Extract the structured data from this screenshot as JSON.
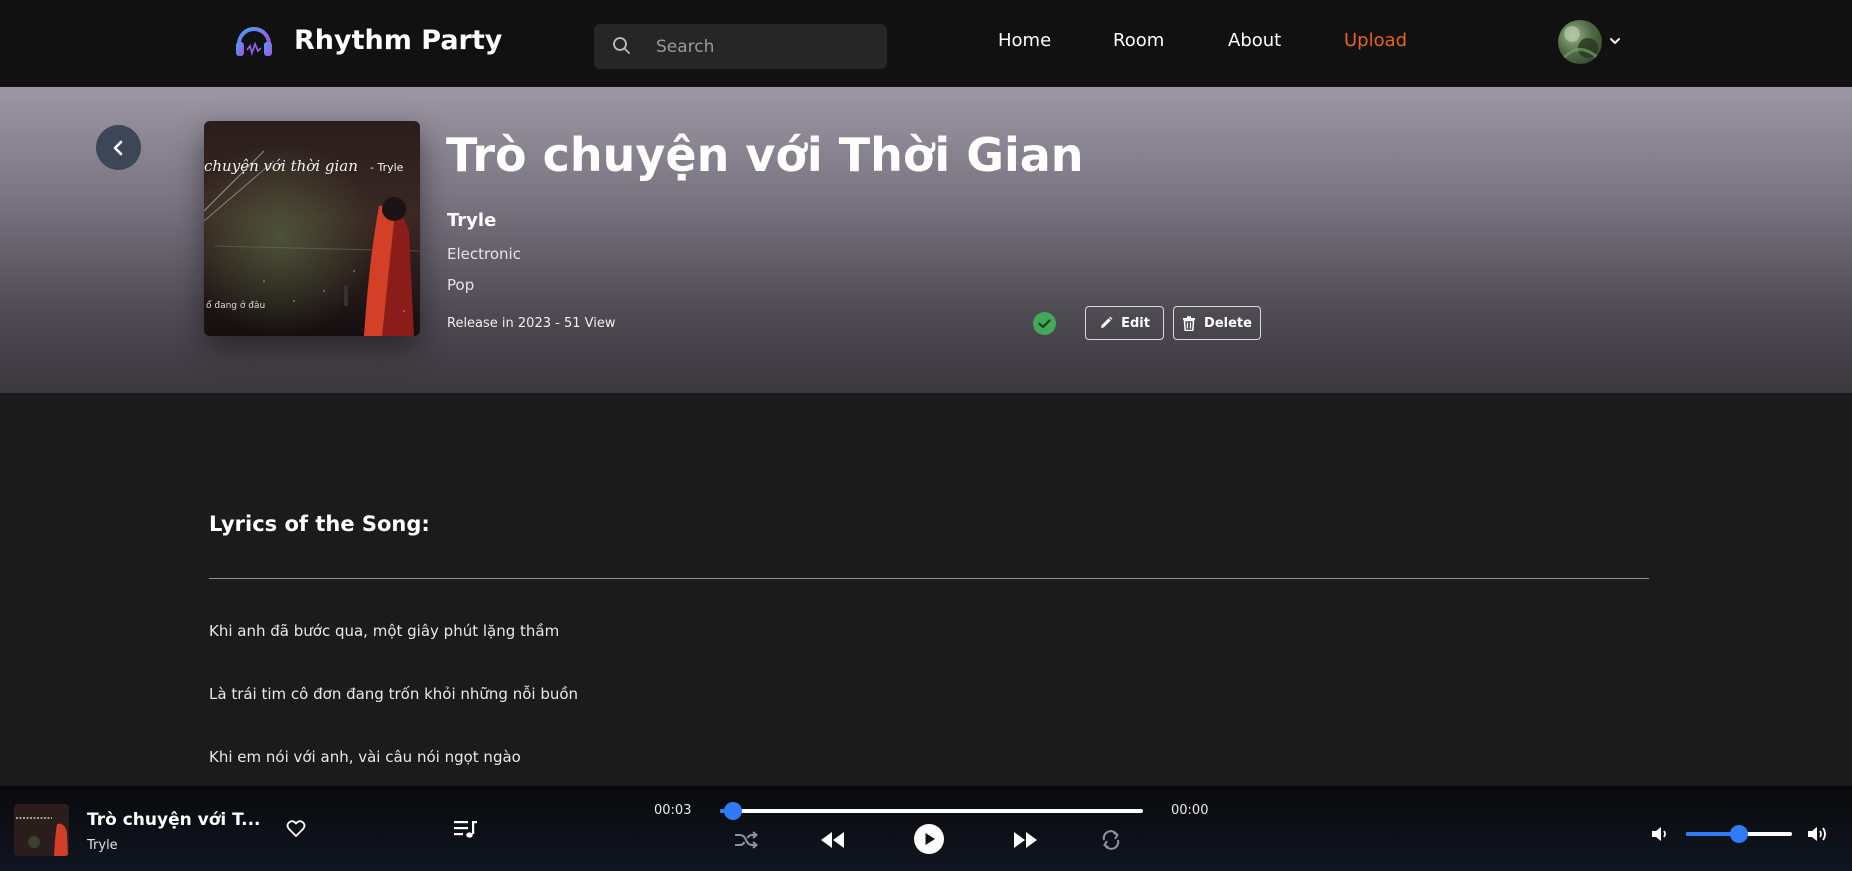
{
  "header": {
    "brand": "Rhythm Party",
    "search_placeholder": "Search",
    "nav": [
      "Home",
      "Room",
      "About",
      "Upload"
    ],
    "accent_color": "#e8641b"
  },
  "song": {
    "title": "Trò chuyện với Thời Gian",
    "artist": "Tryle",
    "genres": [
      "Electronic",
      "Pop"
    ],
    "release_info": "Release in 2023 - 51 View",
    "cover_text": "chuyện với thời gian",
    "cover_artist_tag": "- Tryle",
    "cover_subtext": "ổ đang ở đâu",
    "verified_icon": "check-circle-icon",
    "edit_label": "Edit",
    "delete_label": "Delete"
  },
  "lyrics": {
    "heading": "Lyrics of the Song:",
    "lines": [
      "Khi anh đã bước qua, một giây phút lặng thầm",
      "Là trái tim cô đơn đang trốn khỏi những nỗi buồn",
      "Khi em nói với anh, vài câu nói ngọt ngào"
    ]
  },
  "player": {
    "title": "Trò chuyện với T...",
    "artist": "Tryle",
    "current_time": "00:03",
    "duration": "00:00",
    "progress": 0.03,
    "volume": 0.5,
    "primary_color": "#2f7bf5"
  }
}
